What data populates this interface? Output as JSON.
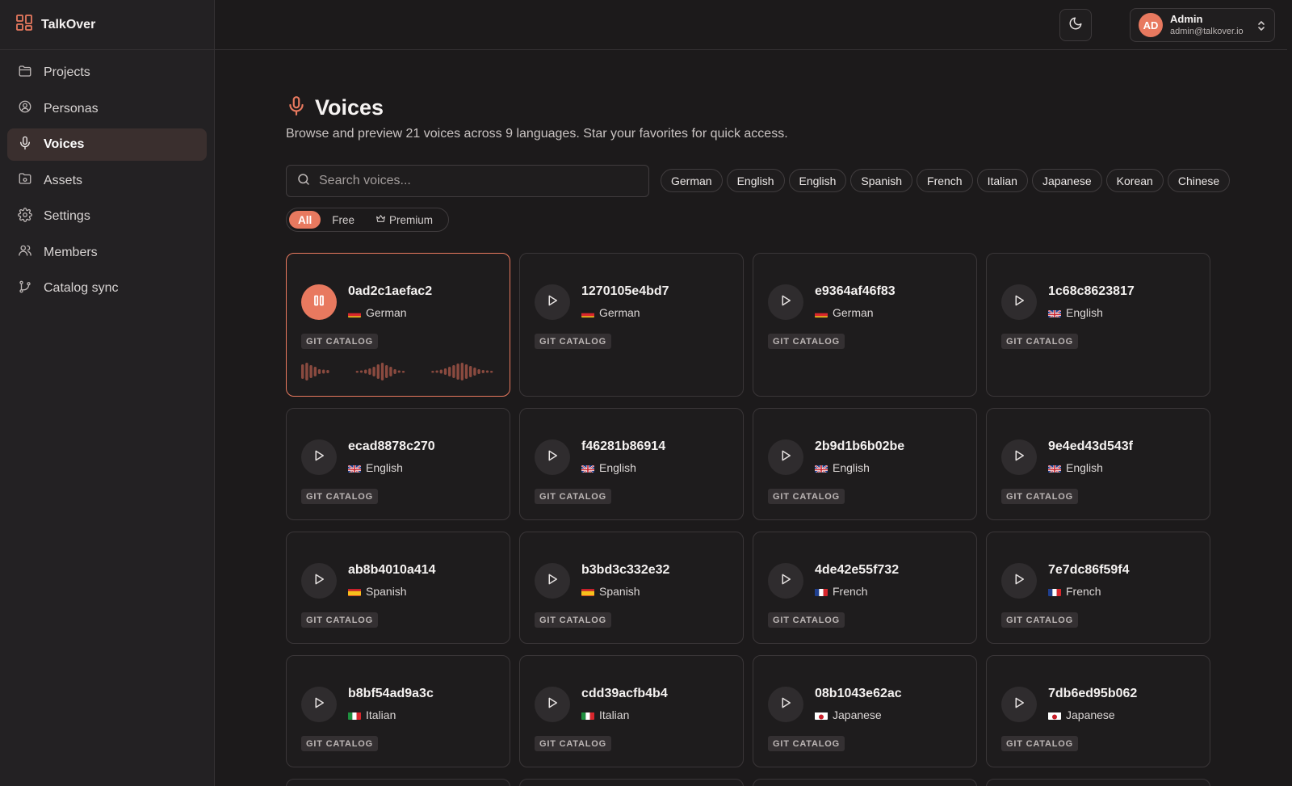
{
  "app": {
    "name": "TalkOver"
  },
  "sidebar": {
    "items": [
      {
        "label": "Projects",
        "icon": "folder-icon",
        "active": false
      },
      {
        "label": "Personas",
        "icon": "user-circle-icon",
        "active": false
      },
      {
        "label": "Voices",
        "icon": "microphone-icon",
        "active": true
      },
      {
        "label": "Assets",
        "icon": "asset-icon",
        "active": false
      },
      {
        "label": "Settings",
        "icon": "gear-icon",
        "active": false
      },
      {
        "label": "Members",
        "icon": "users-icon",
        "active": false
      },
      {
        "label": "Catalog sync",
        "icon": "git-branch-icon",
        "active": false
      }
    ]
  },
  "header": {
    "theme_toggle_icon": "moon-icon",
    "user": {
      "initials": "AD",
      "name": "Admin",
      "email": "admin@talkover.io"
    }
  },
  "page": {
    "title": "Voices",
    "subtitle": "Browse and preview 21 voices across 9 languages. Star your favorites for quick access.",
    "search_placeholder": "Search voices..."
  },
  "language_filters": [
    "German",
    "English",
    "English",
    "Spanish",
    "French",
    "Italian",
    "Japanese",
    "Korean",
    "Chinese"
  ],
  "tier_filters": [
    {
      "label": "All",
      "active": true
    },
    {
      "label": "Free",
      "active": false
    },
    {
      "label": "Premium",
      "active": false,
      "icon": "crown-icon"
    }
  ],
  "voices": [
    {
      "id": "0ad2c1aefac2",
      "language": "German",
      "flag": "de",
      "badge": "GIT CATALOG",
      "playing": true
    },
    {
      "id": "1270105e4bd7",
      "language": "German",
      "flag": "de",
      "badge": "GIT CATALOG",
      "playing": false
    },
    {
      "id": "e9364af46f83",
      "language": "German",
      "flag": "de",
      "badge": "GIT CATALOG",
      "playing": false
    },
    {
      "id": "1c68c8623817",
      "language": "English",
      "flag": "gb",
      "badge": "GIT CATALOG",
      "playing": false
    },
    {
      "id": "ecad8878c270",
      "language": "English",
      "flag": "gb",
      "badge": "GIT CATALOG",
      "playing": false
    },
    {
      "id": "f46281b86914",
      "language": "English",
      "flag": "gb",
      "badge": "GIT CATALOG",
      "playing": false
    },
    {
      "id": "2b9d1b6b02be",
      "language": "English",
      "flag": "gb",
      "badge": "GIT CATALOG",
      "playing": false
    },
    {
      "id": "9e4ed43d543f",
      "language": "English",
      "flag": "gb",
      "badge": "GIT CATALOG",
      "playing": false
    },
    {
      "id": "ab8b4010a414",
      "language": "Spanish",
      "flag": "es",
      "badge": "GIT CATALOG",
      "playing": false
    },
    {
      "id": "b3bd3c332e32",
      "language": "Spanish",
      "flag": "es",
      "badge": "GIT CATALOG",
      "playing": false
    },
    {
      "id": "4de42e55f732",
      "language": "French",
      "flag": "fr",
      "badge": "GIT CATALOG",
      "playing": false
    },
    {
      "id": "7e7dc86f59f4",
      "language": "French",
      "flag": "fr",
      "badge": "GIT CATALOG",
      "playing": false
    },
    {
      "id": "b8bf54ad9a3c",
      "language": "Italian",
      "flag": "it",
      "badge": "GIT CATALOG",
      "playing": false
    },
    {
      "id": "cdd39acfb4b4",
      "language": "Italian",
      "flag": "it",
      "badge": "GIT CATALOG",
      "playing": false
    },
    {
      "id": "08b1043e62ac",
      "language": "Japanese",
      "flag": "jp",
      "badge": "GIT CATALOG",
      "playing": false
    },
    {
      "id": "7db6ed95b062",
      "language": "Japanese",
      "flag": "jp",
      "badge": "GIT CATALOG",
      "playing": false
    }
  ],
  "colors": {
    "accent": "#e8795f",
    "background": "#1c1a1b",
    "card_border": "#3a3638"
  }
}
